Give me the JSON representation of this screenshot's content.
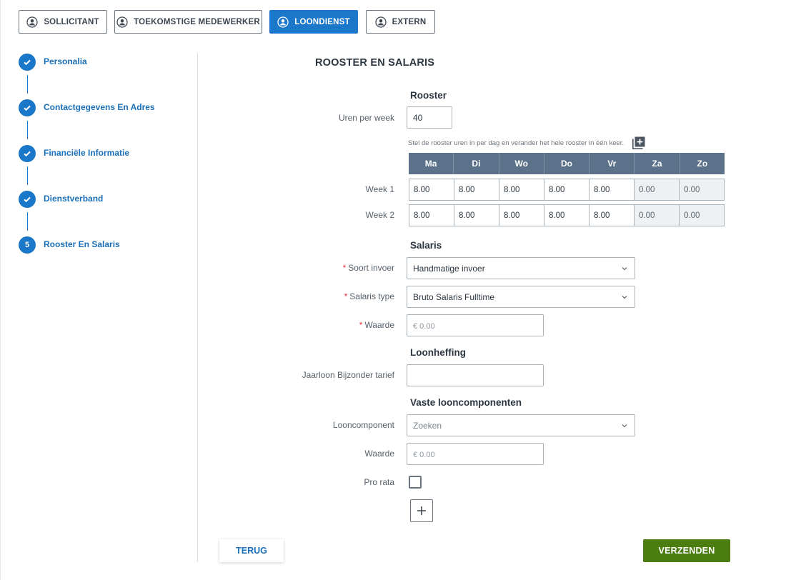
{
  "roles": [
    {
      "label": "SOLLICITANT",
      "active": false
    },
    {
      "label": "TOEKOMSTIGE MEDEWERKER",
      "active": false
    },
    {
      "label": "LOONDIENST",
      "active": true
    },
    {
      "label": "EXTERN",
      "active": false
    }
  ],
  "steps": [
    {
      "label": "Personalia",
      "status": "done"
    },
    {
      "label": "Contactgegevens En Adres",
      "status": "done"
    },
    {
      "label": "Financiële Informatie",
      "status": "done"
    },
    {
      "label": "Dienstverband",
      "status": "done"
    },
    {
      "label": "Rooster En Salaris",
      "status": "current",
      "number": "5"
    }
  ],
  "section_title": "ROOSTER EN SALARIS",
  "rooster": {
    "title": "Rooster",
    "hours_label": "Uren per week",
    "hours_value": "40",
    "hint": "Stel de rooster uren in per dag en verander het hele rooster in één keer.",
    "days": [
      "Ma",
      "Di",
      "Wo",
      "Do",
      "Vr",
      "Za",
      "Zo"
    ],
    "weeks": [
      {
        "label": "Week 1",
        "values": [
          "8.00",
          "8.00",
          "8.00",
          "8.00",
          "8.00",
          "0.00",
          "0.00"
        ]
      },
      {
        "label": "Week 2",
        "values": [
          "8.00",
          "8.00",
          "8.00",
          "8.00",
          "8.00",
          "0.00",
          "0.00"
        ]
      }
    ]
  },
  "salaris": {
    "title": "Salaris",
    "soort_label": "Soort invoer",
    "soort_value": "Handmatige invoer",
    "type_label": "Salaris type",
    "type_value": "Bruto Salaris Fulltime",
    "waarde_label": "Waarde",
    "waarde_placeholder": "€ 0.00"
  },
  "loonheffing": {
    "title": "Loonheffing",
    "jaarloon_label": "Jaarloon Bijzonder tarief",
    "jaarloon_value": ""
  },
  "vaste": {
    "title": "Vaste looncomponenten",
    "component_label": "Looncomponent",
    "component_placeholder": "Zoeken",
    "waarde_label": "Waarde",
    "waarde_placeholder": "€ 0.00",
    "prorata_label": "Pro rata",
    "prorata_checked": false
  },
  "required_mark": "*",
  "buttons": {
    "back": "TERUG",
    "submit": "VERZENDEN"
  },
  "colors": {
    "primary": "#1a77c9",
    "submit": "#4c7d10",
    "grid_header": "#5b728a"
  }
}
